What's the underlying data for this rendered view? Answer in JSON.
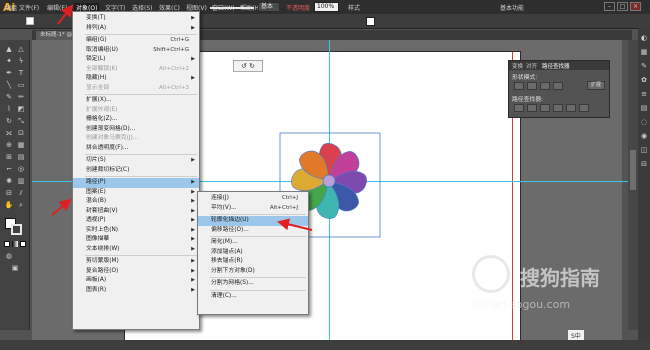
{
  "app": {
    "logo": "Ai",
    "workspace": "基本功能"
  },
  "menubar": {
    "items": [
      "文件(F)",
      "编辑(E)",
      "对象(O)",
      "文字(T)",
      "选择(S)",
      "效果(C)",
      "视图(V)",
      "窗口(W)",
      "帮助(H)"
    ]
  },
  "control_bar": {
    "group_label": "编组",
    "stroke_style": "基本",
    "opacity_label": "不透明度",
    "opacity_value": "100%",
    "style_label": "样式"
  },
  "document": {
    "tab_title": "未标题-1* @ ..."
  },
  "object_menu": {
    "items": [
      {
        "label": "变换(T)",
        "sub": true
      },
      {
        "label": "排列(A)",
        "sub": true
      },
      {
        "sep": true
      },
      {
        "label": "编组(G)",
        "shortcut": "Ctrl+G"
      },
      {
        "label": "取消编组(U)",
        "shortcut": "Shift+Ctrl+G"
      },
      {
        "label": "锁定(L)",
        "sub": true
      },
      {
        "label": "全部解锁(K)",
        "shortcut": "Alt+Ctrl+2",
        "disabled": true
      },
      {
        "label": "隐藏(H)",
        "sub": true
      },
      {
        "label": "显示全部",
        "shortcut": "Alt+Ctrl+3",
        "disabled": true
      },
      {
        "sep": true
      },
      {
        "label": "扩展(X)..."
      },
      {
        "label": "扩展外观(E)",
        "disabled": true
      },
      {
        "label": "栅格化(Z)..."
      },
      {
        "label": "创建渐变网格(D)..."
      },
      {
        "label": "创建对象马赛克(J)...",
        "disabled": true
      },
      {
        "label": "拼合透明度(F)..."
      },
      {
        "sep": true
      },
      {
        "label": "切片(S)",
        "sub": true
      },
      {
        "label": "创建裁切标记(C)"
      },
      {
        "sep": true
      },
      {
        "label": "路径(P)",
        "sub": true,
        "highlight": true
      },
      {
        "label": "图案(E)",
        "sub": true
      },
      {
        "label": "混合(B)",
        "sub": true
      },
      {
        "label": "封套扭曲(V)",
        "sub": true
      },
      {
        "label": "透视(P)",
        "sub": true
      },
      {
        "label": "实时上色(N)",
        "sub": true
      },
      {
        "label": "图像描摹",
        "sub": true
      },
      {
        "label": "文本绕排(W)",
        "sub": true
      },
      {
        "sep": true
      },
      {
        "label": "剪切蒙版(M)",
        "sub": true
      },
      {
        "label": "复合路径(O)",
        "sub": true
      },
      {
        "label": "画板(A)",
        "sub": true
      },
      {
        "label": "图表(R)",
        "sub": true
      }
    ]
  },
  "path_submenu": {
    "items": [
      {
        "label": "连接(J)",
        "shortcut": "Ctrl+J"
      },
      {
        "label": "平均(V)...",
        "shortcut": "Alt+Ctrl+J"
      },
      {
        "sep": true
      },
      {
        "label": "轮廓化描边(U)",
        "highlight": true
      },
      {
        "label": "偏移路径(O)..."
      },
      {
        "sep": true
      },
      {
        "label": "简化(M)..."
      },
      {
        "label": "添加锚点(A)"
      },
      {
        "label": "移去锚点(R)"
      },
      {
        "label": "分割下方对象(D)"
      },
      {
        "sep": true
      },
      {
        "label": "分割为网格(S)..."
      },
      {
        "sep": true
      },
      {
        "label": "清理(C)..."
      }
    ]
  },
  "pathfinder_panel": {
    "tabs": [
      "变换",
      "对齐",
      "路径查找器"
    ],
    "shape_modes_label": "形状模式:",
    "expand_label": "扩展",
    "pathfinders_label": "路径查找器:"
  },
  "flower": {
    "petal_colors": [
      "#d9414f",
      "#c03f98",
      "#7f4ab0",
      "#3e58a8",
      "#3fb6b0",
      "#43a64a",
      "#dcaa33",
      "#e07a2a"
    ],
    "center_color": "#b8a0d8"
  },
  "watermark": {
    "brand": "搜狗指南",
    "url": "zhinan.sogou.com"
  },
  "taskbar": {
    "sogou": "S中"
  }
}
